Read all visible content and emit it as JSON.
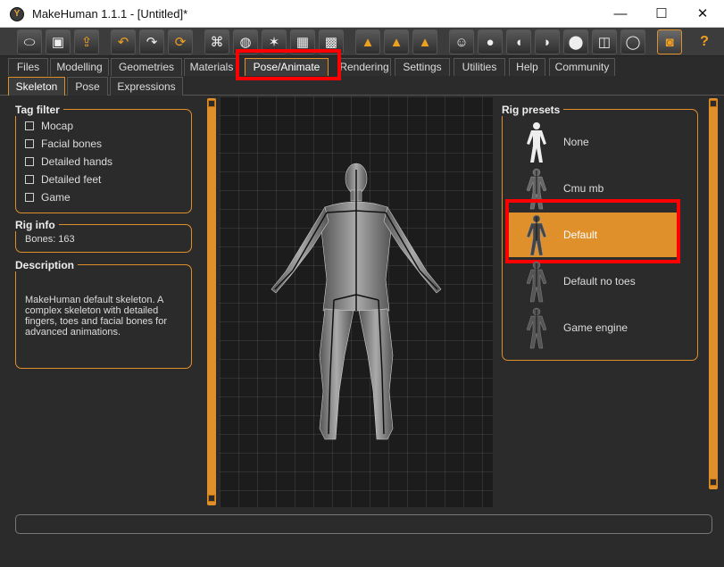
{
  "window": {
    "title": "MakeHuman 1.1.1 - [Untitled]*",
    "app_icon_glyph": "Y"
  },
  "window_controls": {
    "minimize": "—",
    "maximize": "☐",
    "close": "✕"
  },
  "toolbar": {
    "icons": [
      "undo-file-icon",
      "save-icon",
      "export-icon",
      "undo-icon",
      "redo-icon",
      "reset-icon",
      "smooth-icon",
      "wireframe-icon",
      "pose-icon",
      "grid-icon",
      "checker-icon",
      "front-view-icon",
      "side-view-icon",
      "back-view-icon",
      "face-front-icon",
      "face-side-icon",
      "head-left-icon",
      "head-right-icon",
      "top-view-icon",
      "symmetry-icon",
      "background-icon",
      "screenshot-icon"
    ],
    "help_label": "?"
  },
  "tabs": [
    "Files",
    "Modelling",
    "Geometries",
    "Materials",
    "Pose/Animate",
    "Rendering",
    "Settings",
    "Utilities",
    "Help",
    "Community"
  ],
  "active_tab": "Pose/Animate",
  "subtabs": [
    "Skeleton",
    "Pose",
    "Expressions"
  ],
  "active_subtab": "Skeleton",
  "tag_filter": {
    "title": "Tag filter",
    "options": [
      "Mocap",
      "Facial bones",
      "Detailed hands",
      "Detailed feet",
      "Game"
    ]
  },
  "rig_info": {
    "title": "Rig info",
    "bones": "Bones: 163"
  },
  "description": {
    "title": "Description",
    "text": "MakeHuman default skeleton. A complex skeleton with detailed fingers, toes and facial bones for advanced animations."
  },
  "rig_presets": {
    "title": "Rig presets",
    "items": [
      "None",
      "Cmu mb",
      "Default",
      "Default no toes",
      "Game engine"
    ],
    "selected": "Default"
  },
  "colors": {
    "accent": "#e0902a",
    "highlight": "#ff0000",
    "background": "#2b2b2b"
  }
}
